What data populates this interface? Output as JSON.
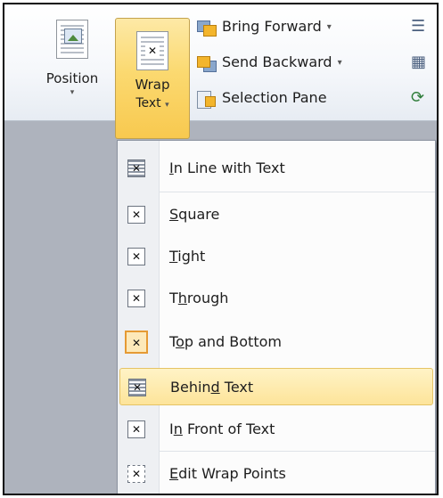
{
  "ribbon": {
    "position": {
      "label": "Position",
      "arrow": "▾"
    },
    "wrap_text": {
      "label_line1": "Wrap",
      "label_line2": "Text",
      "arrow": "▾"
    },
    "bring_forward": {
      "label": "Bring Forward",
      "arrow": "▾"
    },
    "send_backward": {
      "label": "Send Backward",
      "arrow": "▾"
    },
    "selection_pane": {
      "label": "Selection Pane"
    },
    "icons": [
      "align-icon",
      "group-icon",
      "rotate-icon"
    ]
  },
  "menu": {
    "items": [
      {
        "label": "In Line with Text",
        "underline": "I",
        "rest": "n Line with Text",
        "icon": "inline-wrap-icon"
      },
      {
        "label": "Square",
        "underline": "S",
        "rest": "quare",
        "icon": "square-wrap-icon"
      },
      {
        "label": "Tight",
        "underline": "T",
        "rest": "ight",
        "icon": "tight-wrap-icon"
      },
      {
        "label": "Through",
        "pre": "T",
        "underline": "h",
        "rest": "rough",
        "icon": "through-wrap-icon"
      },
      {
        "label": "Top and Bottom",
        "pre": "T",
        "underline": "o",
        "rest": "p and Bottom",
        "icon": "top-bottom-wrap-icon",
        "checked": true
      },
      {
        "label": "Behind Text",
        "pre": "Behin",
        "underline": "d",
        "rest": " Text",
        "icon": "behind-text-icon",
        "highlighted": true
      },
      {
        "label": "In Front of Text",
        "pre": "I",
        "underline": "n",
        "rest": " Front of Text",
        "icon": "in-front-text-icon"
      },
      {
        "label": "Edit Wrap Points",
        "underline": "E",
        "rest": "dit Wrap Points",
        "icon": "edit-wrap-points-icon"
      }
    ]
  },
  "colors": {
    "accent_highlight": "#fde49a",
    "wrap_button": "#fbd970",
    "checked_border": "#e59a34"
  }
}
